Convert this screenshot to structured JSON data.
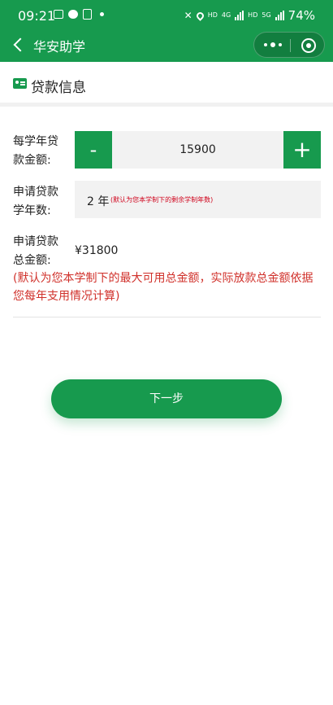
{
  "status_bar": {
    "time": "09:21",
    "network_labels": [
      "HD",
      "4G",
      "HD",
      "5G"
    ],
    "battery": "74%"
  },
  "nav": {
    "title": "华安助学"
  },
  "section": {
    "title": "贷款信息"
  },
  "form": {
    "annual_amount": {
      "label_line1": "每学年贷",
      "label_line2": "款金额:",
      "minus_label": "-",
      "plus_label": "+",
      "value": "15900"
    },
    "years": {
      "label_line1": "申请贷款",
      "label_line2": "学年数:",
      "value": "2 年",
      "note": "(默认为您本学制下的剩余学制年数)"
    },
    "total": {
      "label_line1": "申请贷款",
      "label_line2": "总金额:",
      "value": "¥31800",
      "note": "(默认为您本学制下的最大可用总金额，实际放款总金额依据您每年支用情况计算)"
    }
  },
  "next_button": {
    "label": "下一步"
  },
  "colors": {
    "brand_green": "#179a4e",
    "note_red": "#d0302a"
  }
}
